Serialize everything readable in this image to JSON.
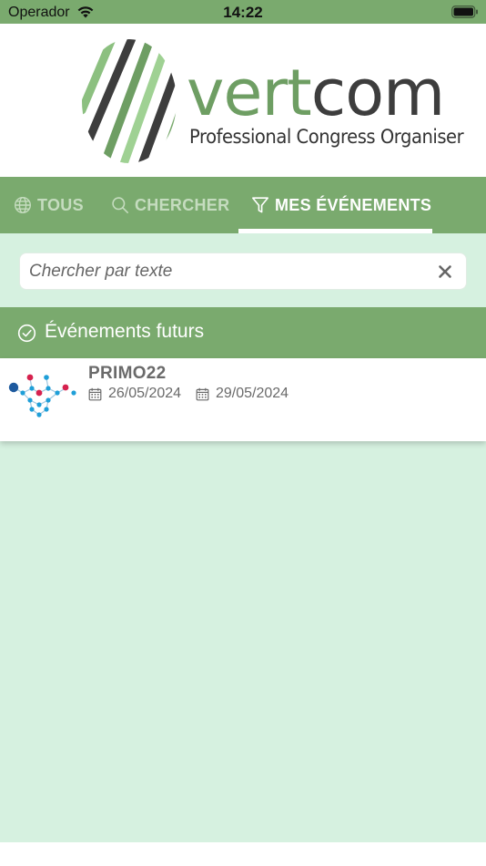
{
  "status_bar": {
    "carrier": "Operador",
    "time": "14:22",
    "wifi_icon": "wifi-icon",
    "battery_icon": "battery-icon"
  },
  "brand": {
    "word_part1": "vert",
    "word_part2": "com",
    "tagline": "Professional Congress Organiser",
    "colors": {
      "green": "#6e9e63",
      "dark": "#3d3d3d"
    }
  },
  "tabs": [
    {
      "label": "TOUS",
      "icon": "globe-icon",
      "active": false
    },
    {
      "label": "CHERCHER",
      "icon": "search-icon",
      "active": false
    },
    {
      "label": "MES ÉVÉNEMENTS",
      "icon": "filter-icon",
      "active": true
    }
  ],
  "search": {
    "placeholder": "Chercher par texte",
    "value": "",
    "clear_icon": "close-icon"
  },
  "section": {
    "title": "Événements futurs",
    "icon": "check-circle-icon"
  },
  "events": [
    {
      "name": "PRIMO22",
      "start_date": "26/05/2024",
      "end_date": "29/05/2024",
      "date_icon": "calendar-icon"
    }
  ],
  "colors": {
    "primary_green": "#7aaa6e",
    "background": "#d6f1e0",
    "tab_inactive": "#c5dcbf",
    "text_grey": "#6a6a6a"
  }
}
